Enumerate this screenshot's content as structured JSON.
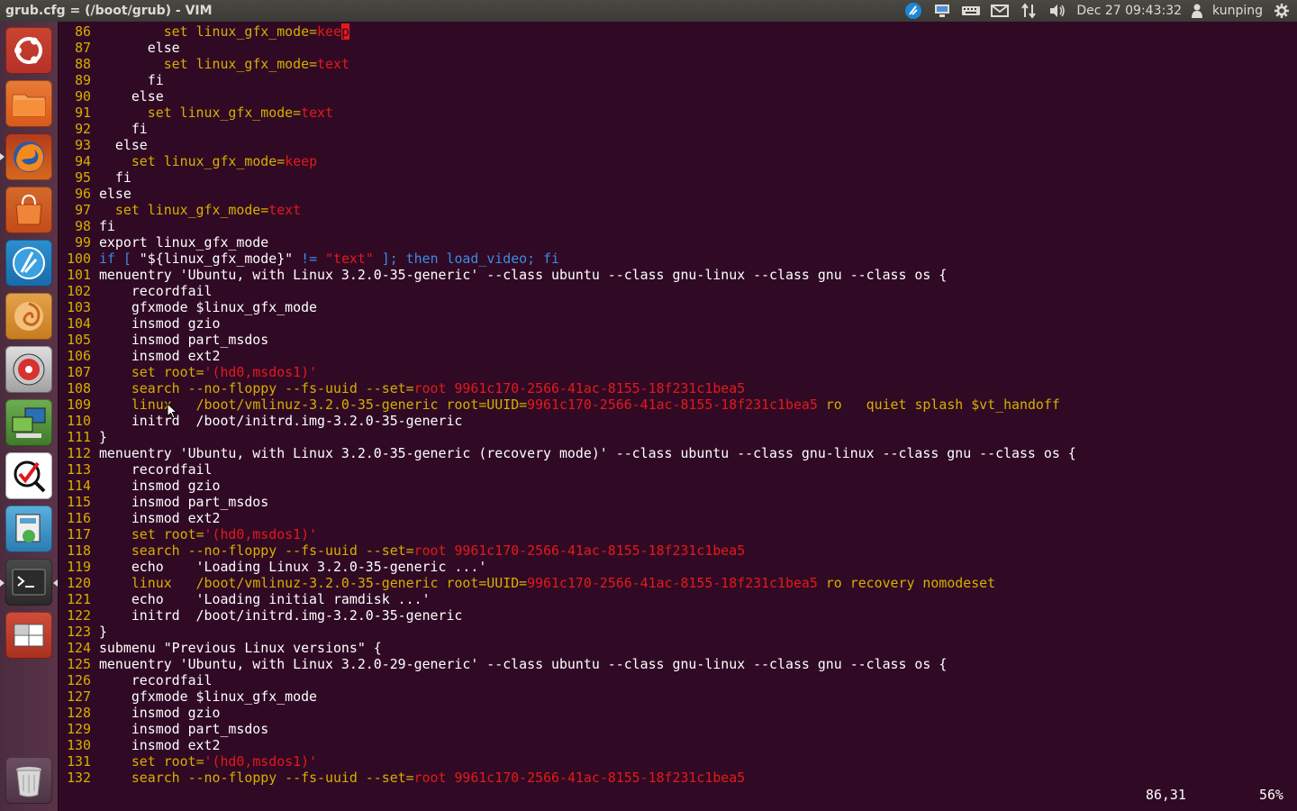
{
  "window": {
    "title": "grub.cfg = (/boot/grub) - VIM"
  },
  "panel": {
    "clock": "Dec 27 09:43:32",
    "username": "kunping"
  },
  "launcher": {
    "items": [
      "dash-home",
      "files",
      "firefox",
      "software-center",
      "chat",
      "blender",
      "disk-utility",
      "system-monitor",
      "rdesktop",
      "system-settings",
      "terminal",
      "workspace-switcher",
      "trash"
    ]
  },
  "colors": {
    "background": "#300a24",
    "line_number": "#d7af00",
    "keyword": "#d7af00",
    "string": "#e5191b",
    "conditional": "#3c8ce6",
    "normal": "#ffffff"
  },
  "editor": {
    "lines": [
      {
        "n": "86",
        "segs": [
          [
            "w",
            "        "
          ],
          [
            "y",
            "set linux_gfx_mode="
          ],
          [
            "r",
            "kee"
          ],
          [
            "cur",
            "p"
          ]
        ]
      },
      {
        "n": "87",
        "segs": [
          [
            "w",
            "      else"
          ]
        ]
      },
      {
        "n": "88",
        "segs": [
          [
            "w",
            "        "
          ],
          [
            "y",
            "set linux_gfx_mode="
          ],
          [
            "r",
            "text"
          ]
        ]
      },
      {
        "n": "89",
        "segs": [
          [
            "w",
            "      fi"
          ]
        ]
      },
      {
        "n": "90",
        "segs": [
          [
            "w",
            "    else"
          ]
        ]
      },
      {
        "n": "91",
        "segs": [
          [
            "w",
            "      "
          ],
          [
            "y",
            "set linux_gfx_mode="
          ],
          [
            "r",
            "text"
          ]
        ]
      },
      {
        "n": "92",
        "segs": [
          [
            "w",
            "    fi"
          ]
        ]
      },
      {
        "n": "93",
        "segs": [
          [
            "w",
            "  else"
          ]
        ]
      },
      {
        "n": "94",
        "segs": [
          [
            "w",
            "    "
          ],
          [
            "y",
            "set linux_gfx_mode="
          ],
          [
            "r",
            "keep"
          ]
        ]
      },
      {
        "n": "95",
        "segs": [
          [
            "w",
            "  fi"
          ]
        ]
      },
      {
        "n": "96",
        "segs": [
          [
            "w",
            "else"
          ]
        ]
      },
      {
        "n": "97",
        "segs": [
          [
            "w",
            "  "
          ],
          [
            "y",
            "set linux_gfx_mode="
          ],
          [
            "r",
            "text"
          ]
        ]
      },
      {
        "n": "98",
        "segs": [
          [
            "w",
            "fi"
          ]
        ]
      },
      {
        "n": "99",
        "segs": [
          [
            "w",
            "export linux_gfx_mode"
          ]
        ]
      },
      {
        "n": "100",
        "segs": [
          [
            "b",
            "if [ "
          ],
          [
            "w",
            "\"${linux_gfx_mode}\""
          ],
          [
            "b",
            " != "
          ],
          [
            "r",
            "\"text\""
          ],
          [
            "b",
            " ]; then load_video; fi"
          ]
        ]
      },
      {
        "n": "101",
        "segs": [
          [
            "w",
            "menuentry 'Ubuntu, with Linux 3.2.0-35-generic' --class ubuntu --class gnu-linux --class gnu --class os {"
          ]
        ]
      },
      {
        "n": "102",
        "segs": [
          [
            "w",
            "    recordfail"
          ]
        ]
      },
      {
        "n": "103",
        "segs": [
          [
            "w",
            "    gfxmode $linux_gfx_mode"
          ]
        ]
      },
      {
        "n": "104",
        "segs": [
          [
            "w",
            "    insmod gzio"
          ]
        ]
      },
      {
        "n": "105",
        "segs": [
          [
            "w",
            "    insmod part_msdos"
          ]
        ]
      },
      {
        "n": "106",
        "segs": [
          [
            "w",
            "    insmod ext2"
          ]
        ]
      },
      {
        "n": "107",
        "segs": [
          [
            "w",
            "    "
          ],
          [
            "y",
            "set root="
          ],
          [
            "r",
            "'(hd0,msdos1)'"
          ]
        ]
      },
      {
        "n": "108",
        "segs": [
          [
            "w",
            "    "
          ],
          [
            "y",
            "search --no-floppy --fs-uuid --set="
          ],
          [
            "r",
            "root 9961c170-2566-41ac-8155-18f231c1bea5"
          ]
        ]
      },
      {
        "n": "109",
        "segs": [
          [
            "w",
            "    "
          ],
          [
            "y",
            "linux   /boot/vmlinuz-3.2.0-35-generic root=UUID="
          ],
          [
            "r",
            "9961c170-2566-41ac-8155-18f231c1bea5"
          ],
          [
            "y",
            " ro   quiet splash $vt_handoff"
          ]
        ]
      },
      {
        "n": "110",
        "segs": [
          [
            "w",
            "    initrd  /boot/initrd.img-3.2.0-35-generic"
          ]
        ]
      },
      {
        "n": "111",
        "segs": [
          [
            "w",
            "}"
          ]
        ]
      },
      {
        "n": "112",
        "segs": [
          [
            "w",
            "menuentry 'Ubuntu, with Linux 3.2.0-35-generic (recovery mode)' --class ubuntu --class gnu-linux --class gnu --class os {"
          ]
        ]
      },
      {
        "n": "113",
        "segs": [
          [
            "w",
            "    recordfail"
          ]
        ]
      },
      {
        "n": "114",
        "segs": [
          [
            "w",
            "    insmod gzio"
          ]
        ]
      },
      {
        "n": "115",
        "segs": [
          [
            "w",
            "    insmod part_msdos"
          ]
        ]
      },
      {
        "n": "116",
        "segs": [
          [
            "w",
            "    insmod ext2"
          ]
        ]
      },
      {
        "n": "117",
        "segs": [
          [
            "w",
            "    "
          ],
          [
            "y",
            "set root="
          ],
          [
            "r",
            "'(hd0,msdos1)'"
          ]
        ]
      },
      {
        "n": "118",
        "segs": [
          [
            "w",
            "    "
          ],
          [
            "y",
            "search --no-floppy --fs-uuid --set="
          ],
          [
            "r",
            "root 9961c170-2566-41ac-8155-18f231c1bea5"
          ]
        ]
      },
      {
        "n": "119",
        "segs": [
          [
            "w",
            "    echo    'Loading Linux 3.2.0-35-generic ...'"
          ]
        ]
      },
      {
        "n": "120",
        "segs": [
          [
            "w",
            "    "
          ],
          [
            "y",
            "linux   /boot/vmlinuz-3.2.0-35-generic root=UUID="
          ],
          [
            "r",
            "9961c170-2566-41ac-8155-18f231c1bea5"
          ],
          [
            "y",
            " ro recovery nomodeset"
          ]
        ]
      },
      {
        "n": "121",
        "segs": [
          [
            "w",
            "    echo    'Loading initial ramdisk ...'"
          ]
        ]
      },
      {
        "n": "122",
        "segs": [
          [
            "w",
            "    initrd  /boot/initrd.img-3.2.0-35-generic"
          ]
        ]
      },
      {
        "n": "123",
        "segs": [
          [
            "w",
            "}"
          ]
        ]
      },
      {
        "n": "124",
        "segs": [
          [
            "w",
            "submenu \"Previous Linux versions\" {"
          ]
        ]
      },
      {
        "n": "125",
        "segs": [
          [
            "w",
            "menuentry 'Ubuntu, with Linux 3.2.0-29-generic' --class ubuntu --class gnu-linux --class gnu --class os {"
          ]
        ]
      },
      {
        "n": "126",
        "segs": [
          [
            "w",
            "    recordfail"
          ]
        ]
      },
      {
        "n": "127",
        "segs": [
          [
            "w",
            "    gfxmode $linux_gfx_mode"
          ]
        ]
      },
      {
        "n": "128",
        "segs": [
          [
            "w",
            "    insmod gzio"
          ]
        ]
      },
      {
        "n": "129",
        "segs": [
          [
            "w",
            "    insmod part_msdos"
          ]
        ]
      },
      {
        "n": "130",
        "segs": [
          [
            "w",
            "    insmod ext2"
          ]
        ]
      },
      {
        "n": "131",
        "segs": [
          [
            "w",
            "    "
          ],
          [
            "y",
            "set root="
          ],
          [
            "r",
            "'(hd0,msdos1)'"
          ]
        ]
      },
      {
        "n": "132",
        "segs": [
          [
            "w",
            "    "
          ],
          [
            "y",
            "search --no-floppy --fs-uuid --set="
          ],
          [
            "r",
            "root 9961c170-2566-41ac-8155-18f231c1bea5"
          ]
        ]
      }
    ]
  },
  "statusline": {
    "position": "86,31",
    "percent": "56%"
  }
}
